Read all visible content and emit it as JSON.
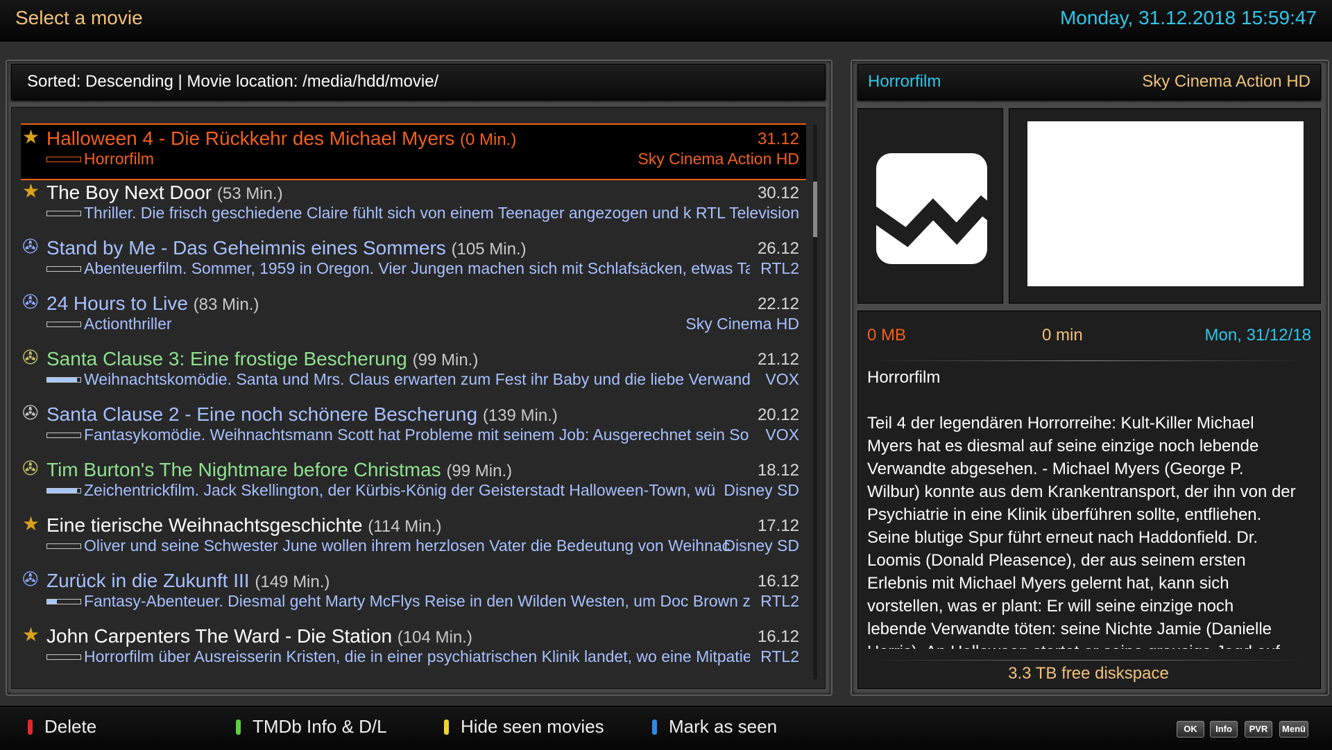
{
  "header": {
    "title": "Select a movie",
    "datetime": "Monday, 31.12.2018  15:59:47"
  },
  "list_header": {
    "text": "Sorted: Descending | Movie location: /media/hdd/movie/"
  },
  "movies": [
    {
      "icon": "star",
      "title": "Halloween 4 - Die Rückkehr des Michael Myers",
      "duration": "(0 Min.)",
      "date": "31.12",
      "description": "Horrorfilm",
      "channel": "Sky Cinema Action HD",
      "progress": 0,
      "title_color": "#f2601a",
      "selected": true
    },
    {
      "icon": "star",
      "title": "The Boy Next Door",
      "duration": "(53 Min.)",
      "date": "30.12",
      "description": "Thriller. Die frisch geschiedene Claire fühlt sich von einem Teenager angezogen und k",
      "channel": "RTL Television",
      "progress": 0,
      "title_color": "#ffffff"
    },
    {
      "icon": "film-reel",
      "title": "Stand by Me - Das Geheimnis eines Sommers",
      "duration": "(105 Min.)",
      "date": "26.12",
      "description": "Abenteuerfilm. Sommer, 1959 in Oregon. Vier Jungen machen sich mit Schlafsäcken, etwas Ta",
      "channel": "RTL2",
      "progress": 0,
      "title_color": "#a7c0ff"
    },
    {
      "icon": "film-reel",
      "title": "24 Hours to Live",
      "duration": "(83 Min.)",
      "date": "22.12",
      "description": "Actionthriller",
      "channel": "Sky Cinema HD",
      "progress": 0,
      "title_color": "#a7c0ff"
    },
    {
      "icon": "film-reel-seen",
      "title": "Santa Clause 3: Eine frostige Bescherung",
      "duration": "(99 Min.)",
      "date": "21.12",
      "description": "Weihnachtskomödie. Santa und Mrs. Claus erwarten zum Fest ihr Baby und die liebe Verwandsc",
      "channel": "VOX",
      "progress": 0.9,
      "title_color": "#8fe08f"
    },
    {
      "icon": "film-reel-grey",
      "title": "Santa Clause 2 - Eine noch schönere Bescherung",
      "duration": "(139 Min.)",
      "date": "20.12",
      "description": "Fantasykomödie. Weihnachtsmann Scott hat Probleme mit seinem Job: Ausgerechnet sein Soh",
      "channel": "VOX",
      "progress": 0,
      "title_color": "#a7c0ff"
    },
    {
      "icon": "film-reel-seen",
      "title": "Tim Burton's The Nightmare before Christmas",
      "duration": "(99 Min.)",
      "date": "18.12",
      "description": "Zeichentrickfilm. Jack Skellington, der Kürbis-König der Geisterstadt Halloween-Town, wü",
      "channel": "Disney SD",
      "progress": 0.9,
      "title_color": "#8fe08f"
    },
    {
      "icon": "star",
      "title": "Eine tierische Weihnachtsgeschichte",
      "duration": "(114 Min.)",
      "date": "17.12",
      "description": "Oliver und seine Schwester June wollen ihrem herzlosen Vater die Bedeutung von Weihnac",
      "channel": "Disney SD",
      "progress": 0,
      "title_color": "#ffffff"
    },
    {
      "icon": "film-reel",
      "title": "Zurück in die Zukunft III",
      "duration": "(149 Min.)",
      "date": "16.12",
      "description": "Fantasy-Abenteuer. Diesmal geht Marty McFlys Reise in den Wilden Westen, um Doc Brown zu r",
      "channel": "RTL2",
      "progress": 0.3,
      "title_color": "#a7c0ff"
    },
    {
      "icon": "star",
      "title": "John Carpenters The Ward - Die Station",
      "duration": "(104 Min.)",
      "date": "16.12",
      "description": "Horrorfilm über Ausreisserin Kristen, die in einer psychiatrischen Klinik landet, wo eine Mitpatie",
      "channel": "RTL2",
      "progress": 0,
      "title_color": "#ffffff"
    }
  ],
  "detail": {
    "genre": "Horrorfilm",
    "channel": "Sky Cinema Action HD",
    "size": "0 MB",
    "length": "0 min",
    "date": "Mon, 31/12/18",
    "desc_genre": "Horrorfilm",
    "description": "Teil 4 der legendären Horrorreihe: Kult-Killer Michael Myers hat es diesmal auf seine einzige noch lebende Verwandte abgesehen. - Michael Myers (George P. Wilbur) konnte aus dem Krankentransport, der ihn von der Psychiatrie in eine Klinik überführen sollte, entfliehen. Seine blutige Spur führt erneut nach Haddonfield. Dr. Loomis (Donald Pleasence), der aus seinem ersten Erlebnis mit Michael Myers gelernt hat, kann sich vorstellen, was er plant: Er will seine einzige noch lebende Verwandte töten: seine Nichte Jamie (Danielle Harris). An Halloween startet er seine grausige Jagd auf",
    "disk_free": "3.3 TB free diskspace"
  },
  "footer": {
    "keys": [
      {
        "label": "Delete",
        "color": "#e8262a"
      },
      {
        "label": "TMDb Info & D/L",
        "color": "#5bd43a"
      },
      {
        "label": "Hide seen movies",
        "color": "#f0d428"
      },
      {
        "label": "Mark as seen",
        "color": "#2f8ae8"
      }
    ],
    "buttons": [
      "OK",
      "Info",
      "PVR",
      "Menü"
    ]
  },
  "colors": {
    "accent_orange": "#f2601a",
    "accent_cyan": "#2fc7e8",
    "accent_gold": "#f2c27a",
    "desc_blue": "#a7c0ff"
  }
}
